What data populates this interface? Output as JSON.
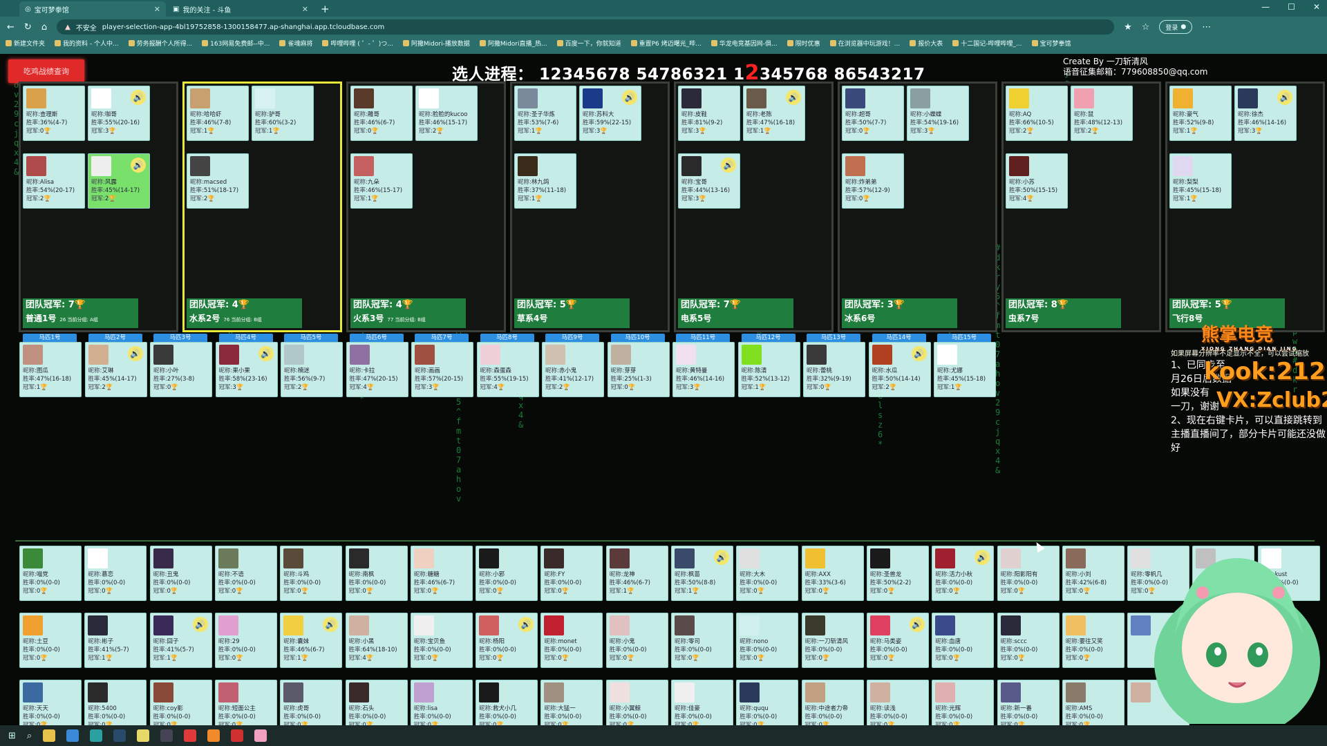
{
  "browser": {
    "tabs": [
      {
        "label": "宝可梦拳馆",
        "active": true
      },
      {
        "label": "我的关注 - 斗鱼",
        "active": false
      }
    ],
    "url": "player-selection-app-4bl19752858-1300158477.ap-shanghai.app.tcloudbase.com",
    "insecure_label": "不安全",
    "login_label": "登录",
    "bookmarks": [
      "新建文件夹",
      "我的资料 - 个人中...",
      "劳务报酬个人所得...",
      "163网易免费邮--中...",
      "雀魂麻将",
      "哔哩哔哩 ( ゜- ゜)つ...",
      "阿撒Midori-播放数据",
      "阿撒Midori直播_热...",
      "百度一下，你就知道",
      "重置P6 烤迈曙光_哔...",
      "华龙电竞基因网-俱...",
      "限时优惠",
      "在浏览器中玩游戏！...",
      "报价大表",
      "十二国记-哔哩哔哩_...",
      "宝可梦拳馆"
    ]
  },
  "app": {
    "query_button": "吃鸡战绩查询",
    "progress_label": "选人进程：",
    "progress_a": "12345678 54786321 1",
    "progress_big": "2",
    "progress_b": "345768 86543217",
    "credit_line1": "Create By 一刀斩清风",
    "credit_line2": "语音征集邮箱：779608850@qq.com",
    "cup_icon": "🏆",
    "label_nick": "昵称:",
    "label_rate": "胜率:",
    "label_champ": "冠军:",
    "teams": [
      {
        "footer_a": "团队冠军: 7",
        "footer_b": "普通1号",
        "pts": "26",
        "ptslabel": "当前分组:",
        "group": "A组",
        "selected": false,
        "cards": [
          {
            "nick": "查理斯",
            "rate": "36%(4-7)",
            "champ": "0",
            "color": "#d9a14a"
          },
          {
            "nick": "咖哥",
            "rate": "55%(20-16)",
            "champ": "3",
            "color": "#ffffff",
            "voice": true
          },
          {
            "nick": "Alisa",
            "rate": "54%(20-17)",
            "champ": "2",
            "color": "#b04b4b"
          },
          {
            "nick": "风露",
            "rate": "45%(14-17)",
            "champ": "2",
            "color": "#eeeeee",
            "voice": true,
            "green": true
          }
        ]
      },
      {
        "footer_a": "团队冠军: 4",
        "footer_b": "水系2号",
        "pts": "76",
        "ptslabel": "当前分组:",
        "group": "B组",
        "selected": true,
        "cards": [
          {
            "nick": "哈哈虾",
            "rate": "46%(7-8)",
            "champ": "1",
            "color": "#c8a070"
          },
          {
            "nick": "驴哥",
            "rate": "60%(3-2)",
            "champ": "1",
            "color": "#d8f2f2"
          },
          {
            "nick": "macsed",
            "rate": "51%(18-17)",
            "champ": "2",
            "color": "#444444"
          }
        ]
      },
      {
        "footer_a": "团队冠军: 4",
        "footer_b": "火系3号",
        "pts": "77",
        "ptslabel": "当前分组:",
        "group": "B组",
        "selected": false,
        "cards": [
          {
            "nick": "雕哥",
            "rate": "46%(6-7)",
            "champ": "0",
            "color": "#5a3a2a"
          },
          {
            "nick": "脸脸的kucoo",
            "rate": "46%(15-17)",
            "champ": "2",
            "color": "#ffffff"
          },
          {
            "nick": "九朵",
            "rate": "46%(15-17)",
            "champ": "1",
            "color": "#c46060"
          }
        ]
      },
      {
        "footer_a": "团队冠军: 5",
        "footer_b": "草系4号",
        "pts": "",
        "ptslabel": "",
        "group": "",
        "selected": false,
        "cards": [
          {
            "nick": "圣子华炼",
            "rate": "53%(7-6)",
            "champ": "1",
            "color": "#7a8a9a"
          },
          {
            "nick": "苏科大",
            "rate": "59%(22-15)",
            "champ": "3",
            "color": "#1a3a8a",
            "voice": true
          },
          {
            "nick": "林九鸽",
            "rate": "37%(11-18)",
            "champ": "1",
            "color": "#3a2a1a"
          }
        ]
      },
      {
        "footer_a": "团队冠军: 7",
        "footer_b": "电系5号",
        "pts": "",
        "ptslabel": "",
        "group": "",
        "selected": false,
        "cards": [
          {
            "nick": "皮鞋",
            "rate": "81%(9-2)",
            "champ": "3",
            "color": "#2a2a3a"
          },
          {
            "nick": "老陈",
            "rate": "47%(16-18)",
            "champ": "1",
            "color": "#6a5a4a",
            "voice": true
          },
          {
            "nick": "宝哥",
            "rate": "44%(13-16)",
            "champ": "3",
            "color": "#2a2a2a",
            "voice": true
          }
        ]
      },
      {
        "footer_a": "团队冠军: 3",
        "footer_b": "冰系6号",
        "pts": "",
        "ptslabel": "",
        "group": "",
        "selected": false,
        "cards": [
          {
            "nick": "超哥",
            "rate": "50%(7-7)",
            "champ": "0",
            "color": "#3a4a7a"
          },
          {
            "nick": "小蝶蝶",
            "rate": "54%(19-16)",
            "champ": "3",
            "color": "#8aa0a0"
          },
          {
            "nick": "炸弟弟",
            "rate": "57%(12-9)",
            "champ": "0",
            "color": "#c07050"
          }
        ]
      },
      {
        "footer_a": "团队冠军: 8",
        "footer_b": "虫系7号",
        "pts": "",
        "ptslabel": "",
        "group": "",
        "selected": false,
        "cards": [
          {
            "nick": "AQ",
            "rate": "66%(10-5)",
            "champ": "2",
            "color": "#f0d030"
          },
          {
            "nick": "鼠",
            "rate": "48%(12-13)",
            "champ": "2",
            "color": "#f0a0b0"
          },
          {
            "nick": "小苏",
            "rate": "50%(15-15)",
            "champ": "4",
            "color": "#602020"
          }
        ]
      },
      {
        "footer_a": "团队冠军: 5",
        "footer_b": "飞行8号",
        "pts": "",
        "ptslabel": "",
        "group": "",
        "selected": false,
        "cards": [
          {
            "nick": "豪气",
            "rate": "52%(9-8)",
            "champ": "1",
            "color": "#f0b030"
          },
          {
            "nick": "徐杰",
            "rate": "46%(14-16)",
            "champ": "3",
            "color": "#2a3a5a",
            "voice": true
          },
          {
            "nick": "梨梨",
            "rate": "45%(15-18)",
            "champ": "1",
            "color": "#e0d8f0"
          }
        ]
      }
    ],
    "horses": [
      {
        "label": "马匹1号",
        "nick": "图瓜",
        "rate": "47%(16-18)",
        "champ": "1",
        "color": "#c09080"
      },
      {
        "label": "马匹2号",
        "nick": "艾琳",
        "rate": "45%(14-17)",
        "champ": "2",
        "color": "#d0b090",
        "voice": true
      },
      {
        "label": "马匹3号",
        "nick": "小叶",
        "rate": "27%(3-8)",
        "champ": "0",
        "color": "#3a3a3a"
      },
      {
        "label": "马匹4号",
        "nick": "果小果",
        "rate": "58%(23-16)",
        "champ": "3",
        "color": "#8a2a3a",
        "voice": true
      },
      {
        "label": "马匹5号",
        "nick": "楠迷",
        "rate": "56%(9-7)",
        "champ": "2",
        "color": "#b0c8c8"
      },
      {
        "label": "马匹6号",
        "nick": "卡拉",
        "rate": "47%(20-15)",
        "champ": "4",
        "color": "#9070a0"
      },
      {
        "label": "马匹7号",
        "nick": "画画",
        "rate": "57%(20-15)",
        "champ": "3",
        "color": "#a05040"
      },
      {
        "label": "马匹8号",
        "nick": "森蛋森",
        "rate": "55%(19-15)",
        "champ": "4",
        "color": "#f0d0d8"
      },
      {
        "label": "马匹9号",
        "nick": "赤小鬼",
        "rate": "41%(12-17)",
        "champ": "2",
        "color": "#d0c0b0"
      },
      {
        "label": "马匹10号",
        "nick": "芽芽",
        "rate": "25%(1-3)",
        "champ": "0",
        "color": "#c0b0a0"
      },
      {
        "label": "马匹11号",
        "nick": "黄特曼",
        "rate": "46%(14-16)",
        "champ": "3",
        "color": "#f0e0f0"
      },
      {
        "label": "马匹12号",
        "nick": "陈清",
        "rate": "52%(13-12)",
        "champ": "1",
        "color": "#80e020"
      },
      {
        "label": "马匹13号",
        "nick": "蕾桃",
        "rate": "32%(9-19)",
        "champ": "0",
        "color": "#3a3a3a"
      },
      {
        "label": "马匹14号",
        "nick": "水瓜",
        "rate": "50%(14-14)",
        "champ": "2",
        "color": "#b04020",
        "voice": true
      },
      {
        "label": "马匹15号",
        "nick": "尤娜",
        "rate": "45%(15-18)",
        "champ": "1",
        "color": "#ffffff"
      }
    ],
    "pool_rows": [
      [
        {
          "nick": "喵党",
          "rate": "0%(0-0)",
          "champ": "0",
          "color": "#3a8a3a"
        },
        {
          "nick": "慕恋",
          "rate": "0%(0-0)",
          "champ": "0",
          "color": "#ffffff"
        },
        {
          "nick": "丑鬼",
          "rate": "0%(0-0)",
          "champ": "0",
          "color": "#3a2a4a"
        },
        {
          "nick": "不语",
          "rate": "0%(0-0)",
          "champ": "0",
          "color": "#6a7a5a"
        },
        {
          "nick": "斗鸡",
          "rate": "0%(0-0)",
          "champ": "0",
          "color": "#5a4a3a"
        },
        {
          "nick": "南枫",
          "rate": "0%(0-0)",
          "champ": "0",
          "color": "#2a2a2a"
        },
        {
          "nick": "糖糖",
          "rate": "46%(6-7)",
          "champ": "0",
          "color": "#f0d0c0"
        },
        {
          "nick": "小邪",
          "rate": "0%(0-0)",
          "champ": "0",
          "color": "#1a1a1a"
        },
        {
          "nick": "FY",
          "rate": "0%(0-0)",
          "champ": "0",
          "color": "#3a2a2a"
        },
        {
          "nick": "龙神",
          "rate": "46%(6-7)",
          "champ": "1",
          "color": "#5a3a3a"
        },
        {
          "nick": "枫苗",
          "rate": "50%(8-8)",
          "champ": "1",
          "color": "#3a4a6a",
          "voice": true
        },
        {
          "nick": "大木",
          "rate": "0%(0-0)",
          "champ": "0",
          "color": "#e0e0e0"
        },
        {
          "nick": "AXX",
          "rate": "33%(3-6)",
          "champ": "0",
          "color": "#f0c030"
        },
        {
          "nick": "圣兽龙",
          "rate": "50%(2-2)",
          "champ": "0",
          "color": "#1a1a1a"
        },
        {
          "nick": "活力小秋",
          "rate": "0%(0-0)",
          "champ": "0",
          "color": "#a02030",
          "voice": true
        },
        {
          "nick": "阳影阳有",
          "rate": "0%(0-0)",
          "champ": "0",
          "color": "#e0d0d0"
        },
        {
          "nick": "小刘",
          "rate": "42%(6-8)",
          "champ": "0",
          "color": "#8a6a5a"
        },
        {
          "nick": "零帆几",
          "rate": "0%(0-0)",
          "champ": "0",
          "color": "#e0e0e0"
        },
        {
          "nick": "",
          "rate": "",
          "champ": "",
          "color": "#c0c0c0"
        },
        {
          "nick": "kust",
          "rate": "0%(0-0)",
          "champ": "0",
          "color": "#ffffff"
        }
      ],
      [
        {
          "nick": "土豆",
          "rate": "0%(0-0)",
          "champ": "0",
          "color": "#f0a030"
        },
        {
          "nick": "彬子",
          "rate": "41%(5-7)",
          "champ": "1",
          "color": "#2a2a3a"
        },
        {
          "nick": "囧子",
          "rate": "41%(5-7)",
          "champ": "1",
          "color": "#3a2a5a",
          "voice": true
        },
        {
          "nick": "29",
          "rate": "0%(0-0)",
          "champ": "0",
          "color": "#e0a0d0"
        },
        {
          "nick": "囊妹",
          "rate": "46%(6-7)",
          "champ": "1",
          "color": "#f0d040",
          "voice": true
        },
        {
          "nick": "小黑",
          "rate": "64%(18-10)",
          "champ": "4",
          "color": "#d0b0a0"
        },
        {
          "nick": "宝贝鱼",
          "rate": "0%(0-0)",
          "champ": "0",
          "color": "#f0f0f0"
        },
        {
          "nick": "杨阳",
          "rate": "0%(0-0)",
          "champ": "0",
          "color": "#d06060",
          "voice": true
        },
        {
          "nick": "monet",
          "rate": "0%(0-0)",
          "champ": "0",
          "color": "#c02030"
        },
        {
          "nick": "小鬼",
          "rate": "0%(0-0)",
          "champ": "0",
          "color": "#e0c0c0"
        },
        {
          "nick": "零司",
          "rate": "0%(0-0)",
          "champ": "0",
          "color": "#5a4a4a"
        },
        {
          "nick": "nono",
          "rate": "0%(0-0)",
          "champ": "0",
          "color": "#d0f0f0"
        },
        {
          "nick": "一刀斩清风",
          "rate": "0%(0-0)",
          "champ": "0",
          "color": "#3a3a2a"
        },
        {
          "nick": "马类姿",
          "rate": "0%(0-0)",
          "champ": "0",
          "color": "#e04060",
          "voice": true
        },
        {
          "nick": "血唐",
          "rate": "0%(0-0)",
          "champ": "0",
          "color": "#3a4a8a"
        },
        {
          "nick": "sccc",
          "rate": "0%(0-0)",
          "champ": "0",
          "color": "#2a2a3a"
        },
        {
          "nick": "要往又笑",
          "rate": "0%(0-0)",
          "champ": "0",
          "color": "#f0c060"
        },
        {
          "nick": "",
          "rate": "",
          "champ": "",
          "color": "#6080c0"
        }
      ],
      [
        {
          "nick": "天天",
          "rate": "0%(0-0)",
          "champ": "0",
          "color": "#3a6aa0"
        },
        {
          "nick": "5400",
          "rate": "0%(0-0)",
          "champ": "0",
          "color": "#2a2a2a"
        },
        {
          "nick": "coy影",
          "rate": "0%(0-0)",
          "champ": "0",
          "color": "#8a4a3a"
        },
        {
          "nick": "短面公主",
          "rate": "0%(0-0)",
          "champ": "0",
          "color": "#c06070"
        },
        {
          "nick": "虎哥",
          "rate": "0%(0-0)",
          "champ": "0",
          "color": "#5a5a6a"
        },
        {
          "nick": "石头",
          "rate": "0%(0-0)",
          "champ": "0",
          "color": "#3a2a2a"
        },
        {
          "nick": "lisa",
          "rate": "0%(0-0)",
          "champ": "0",
          "color": "#c0a0d0"
        },
        {
          "nick": "救犬小几",
          "rate": "0%(0-0)",
          "champ": "0",
          "color": "#1a1a1a"
        },
        {
          "nick": "大猛一",
          "rate": "0%(0-0)",
          "champ": "0",
          "color": "#a09080"
        },
        {
          "nick": "小翼鲸",
          "rate": "0%(0-0)",
          "champ": "0",
          "color": "#f0e0e0"
        },
        {
          "nick": "佳豪",
          "rate": "0%(0-0)",
          "champ": "0",
          "color": "#f0f0f0"
        },
        {
          "nick": "ququ",
          "rate": "0%(0-0)",
          "champ": "0",
          "color": "#2a3a5a"
        },
        {
          "nick": "中途者力帝",
          "rate": "0%(0-0)",
          "champ": "0",
          "color": "#c0a080"
        },
        {
          "nick": "读浅",
          "rate": "0%(0-0)",
          "champ": "0",
          "color": "#d0b0a0"
        },
        {
          "nick": "光辉",
          "rate": "0%(0-0)",
          "champ": "0",
          "color": "#e0b0b0"
        },
        {
          "nick": "新一番",
          "rate": "0%(0-0)",
          "champ": "0",
          "color": "#5a5a8a"
        },
        {
          "nick": "AMS",
          "rate": "0%(0-0)",
          "champ": "0",
          "color": "#8a7a6a"
        },
        {
          "nick": "",
          "rate": "",
          "champ": "",
          "color": "#d0b0a0"
        }
      ]
    ],
    "side_brand": "熊掌电竞",
    "side_brand_sub": "XIONG ZHANG DIAN JING",
    "side_kook": "kook:212",
    "side_vx": "VX:Zclub212",
    "side_note_small": "如果屏幕分辨率不足显示不全，可以尝试缩放",
    "side_note_1": "1、已同步至",
    "side_note_2": "月26日后数据",
    "side_note_3": "如果没有",
    "side_note_4": "一刀，谢谢",
    "side_note_5": "2、现在右键卡片，可以直接跳转到主播直播间了，部分卡片可能还没做好"
  },
  "colors": {
    "team_footer": "#1f7d3e",
    "card_bg": "#c6ece8",
    "selected_border": "#e8e83a",
    "horse_label": "#2d8fe2",
    "accent_red": "#e02929"
  }
}
